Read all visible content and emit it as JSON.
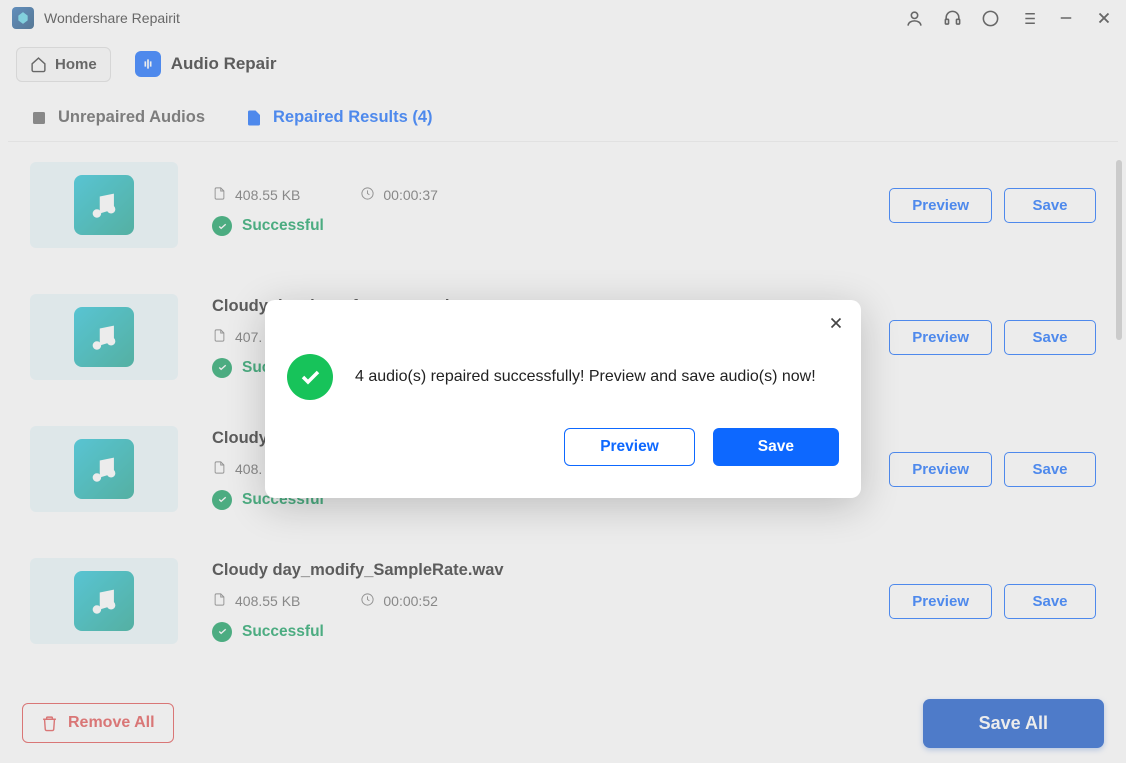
{
  "app": {
    "title": "Wondershare Repairit"
  },
  "toolbar": {
    "home": "Home",
    "section": "Audio Repair"
  },
  "tabs": {
    "unrepaired": "Unrepaired Audios",
    "repaired": "Repaired Results (4)"
  },
  "labels": {
    "preview": "Preview",
    "save": "Save",
    "successful": "Successful"
  },
  "items": [
    {
      "name": "",
      "size": "408.55 KB",
      "duration": "00:00:37"
    },
    {
      "name": "Cloudy day_lose_front_part_data.wav",
      "size": "407.",
      "duration": ""
    },
    {
      "name": "Cloudy",
      "size": "408.",
      "duration": ""
    },
    {
      "name": "Cloudy day_modify_SampleRate.wav",
      "size": "408.55 KB",
      "duration": "00:00:52"
    }
  ],
  "footer": {
    "removeAll": "Remove All",
    "saveAll": "Save All"
  },
  "modal": {
    "message": "4 audio(s) repaired successfully! Preview and save audio(s) now!",
    "preview": "Preview",
    "save": "Save"
  }
}
